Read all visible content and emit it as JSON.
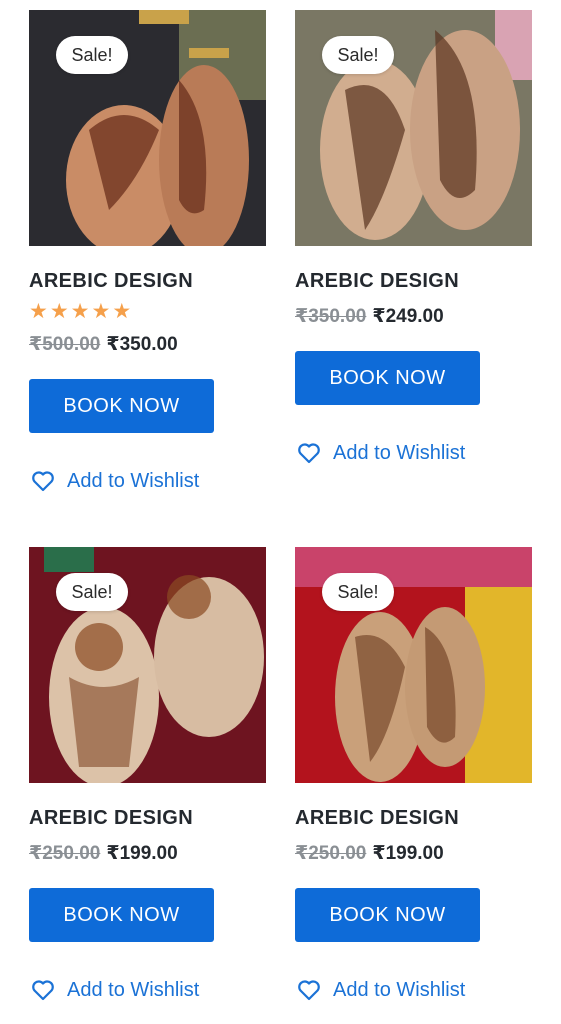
{
  "products": [
    {
      "badge": "Sale!",
      "title": "AREBIC DESIGN",
      "rating_stars": 5,
      "old_price": "₹500.00",
      "new_price": "₹350.00",
      "button_label": "BOOK NOW",
      "wishlist_label": "Add to Wishlist"
    },
    {
      "badge": "Sale!",
      "title": "AREBIC DESIGN",
      "old_price": "₹350.00",
      "new_price": "₹249.00",
      "button_label": "BOOK NOW",
      "wishlist_label": "Add to Wishlist"
    },
    {
      "badge": "Sale!",
      "title": "AREBIC DESIGN",
      "old_price": "₹250.00",
      "new_price": "₹199.00",
      "button_label": "BOOK NOW",
      "wishlist_label": "Add to Wishlist"
    },
    {
      "badge": "Sale!",
      "title": "AREBIC DESIGN",
      "old_price": "₹250.00",
      "new_price": "₹199.00",
      "button_label": "BOOK NOW",
      "wishlist_label": "Add to Wishlist"
    }
  ],
  "colors": {
    "button": "#0e6bd8",
    "link": "#1b72d6",
    "star": "#f5a04b",
    "old_price": "#8a8f94"
  },
  "icons": {
    "wishlist": "heart-outline-icon",
    "rating": "star-icon"
  }
}
